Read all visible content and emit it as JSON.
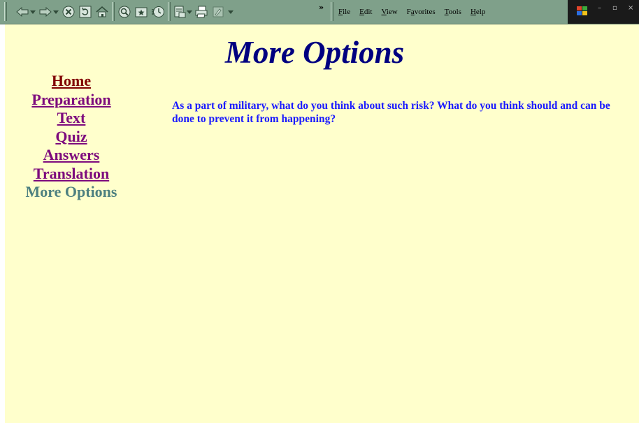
{
  "colors": {
    "page_background": "#ffffcc",
    "toolbar_background": "#7fa08a",
    "title": "#000080",
    "link": "#7d0b7d",
    "visited_link": "#800000",
    "current_page": "#4d8080",
    "body_text": "#1a1aff"
  },
  "toolbar": {
    "icons": [
      "back-icon",
      "forward-icon",
      "stop-icon",
      "refresh-icon",
      "home-icon",
      "search-icon",
      "favorites-icon",
      "history-icon",
      "mail-icon",
      "print-icon",
      "edit-icon"
    ],
    "chevron": "»",
    "menu": [
      {
        "pre": "",
        "u": "F",
        "post": "ile"
      },
      {
        "pre": "",
        "u": "E",
        "post": "dit"
      },
      {
        "pre": "",
        "u": "V",
        "post": "iew"
      },
      {
        "pre": "F",
        "u": "a",
        "post": "vorites"
      },
      {
        "pre": "",
        "u": "T",
        "post": "ools"
      },
      {
        "pre": "",
        "u": "H",
        "post": "elp"
      }
    ]
  },
  "page": {
    "title": "More Options",
    "nav": [
      {
        "label": "Home",
        "visited": true
      },
      {
        "label": "Preparation",
        "visited": false
      },
      {
        "label": "Text",
        "visited": false
      },
      {
        "label": "Quiz",
        "visited": false
      },
      {
        "label": "Answers",
        "visited": false
      },
      {
        "label": "Translation",
        "visited": false
      }
    ],
    "current_page": "More Options",
    "question": "As a part of military, what do you think about such risk? What do you think should and can be done to prevent it from happening?"
  }
}
